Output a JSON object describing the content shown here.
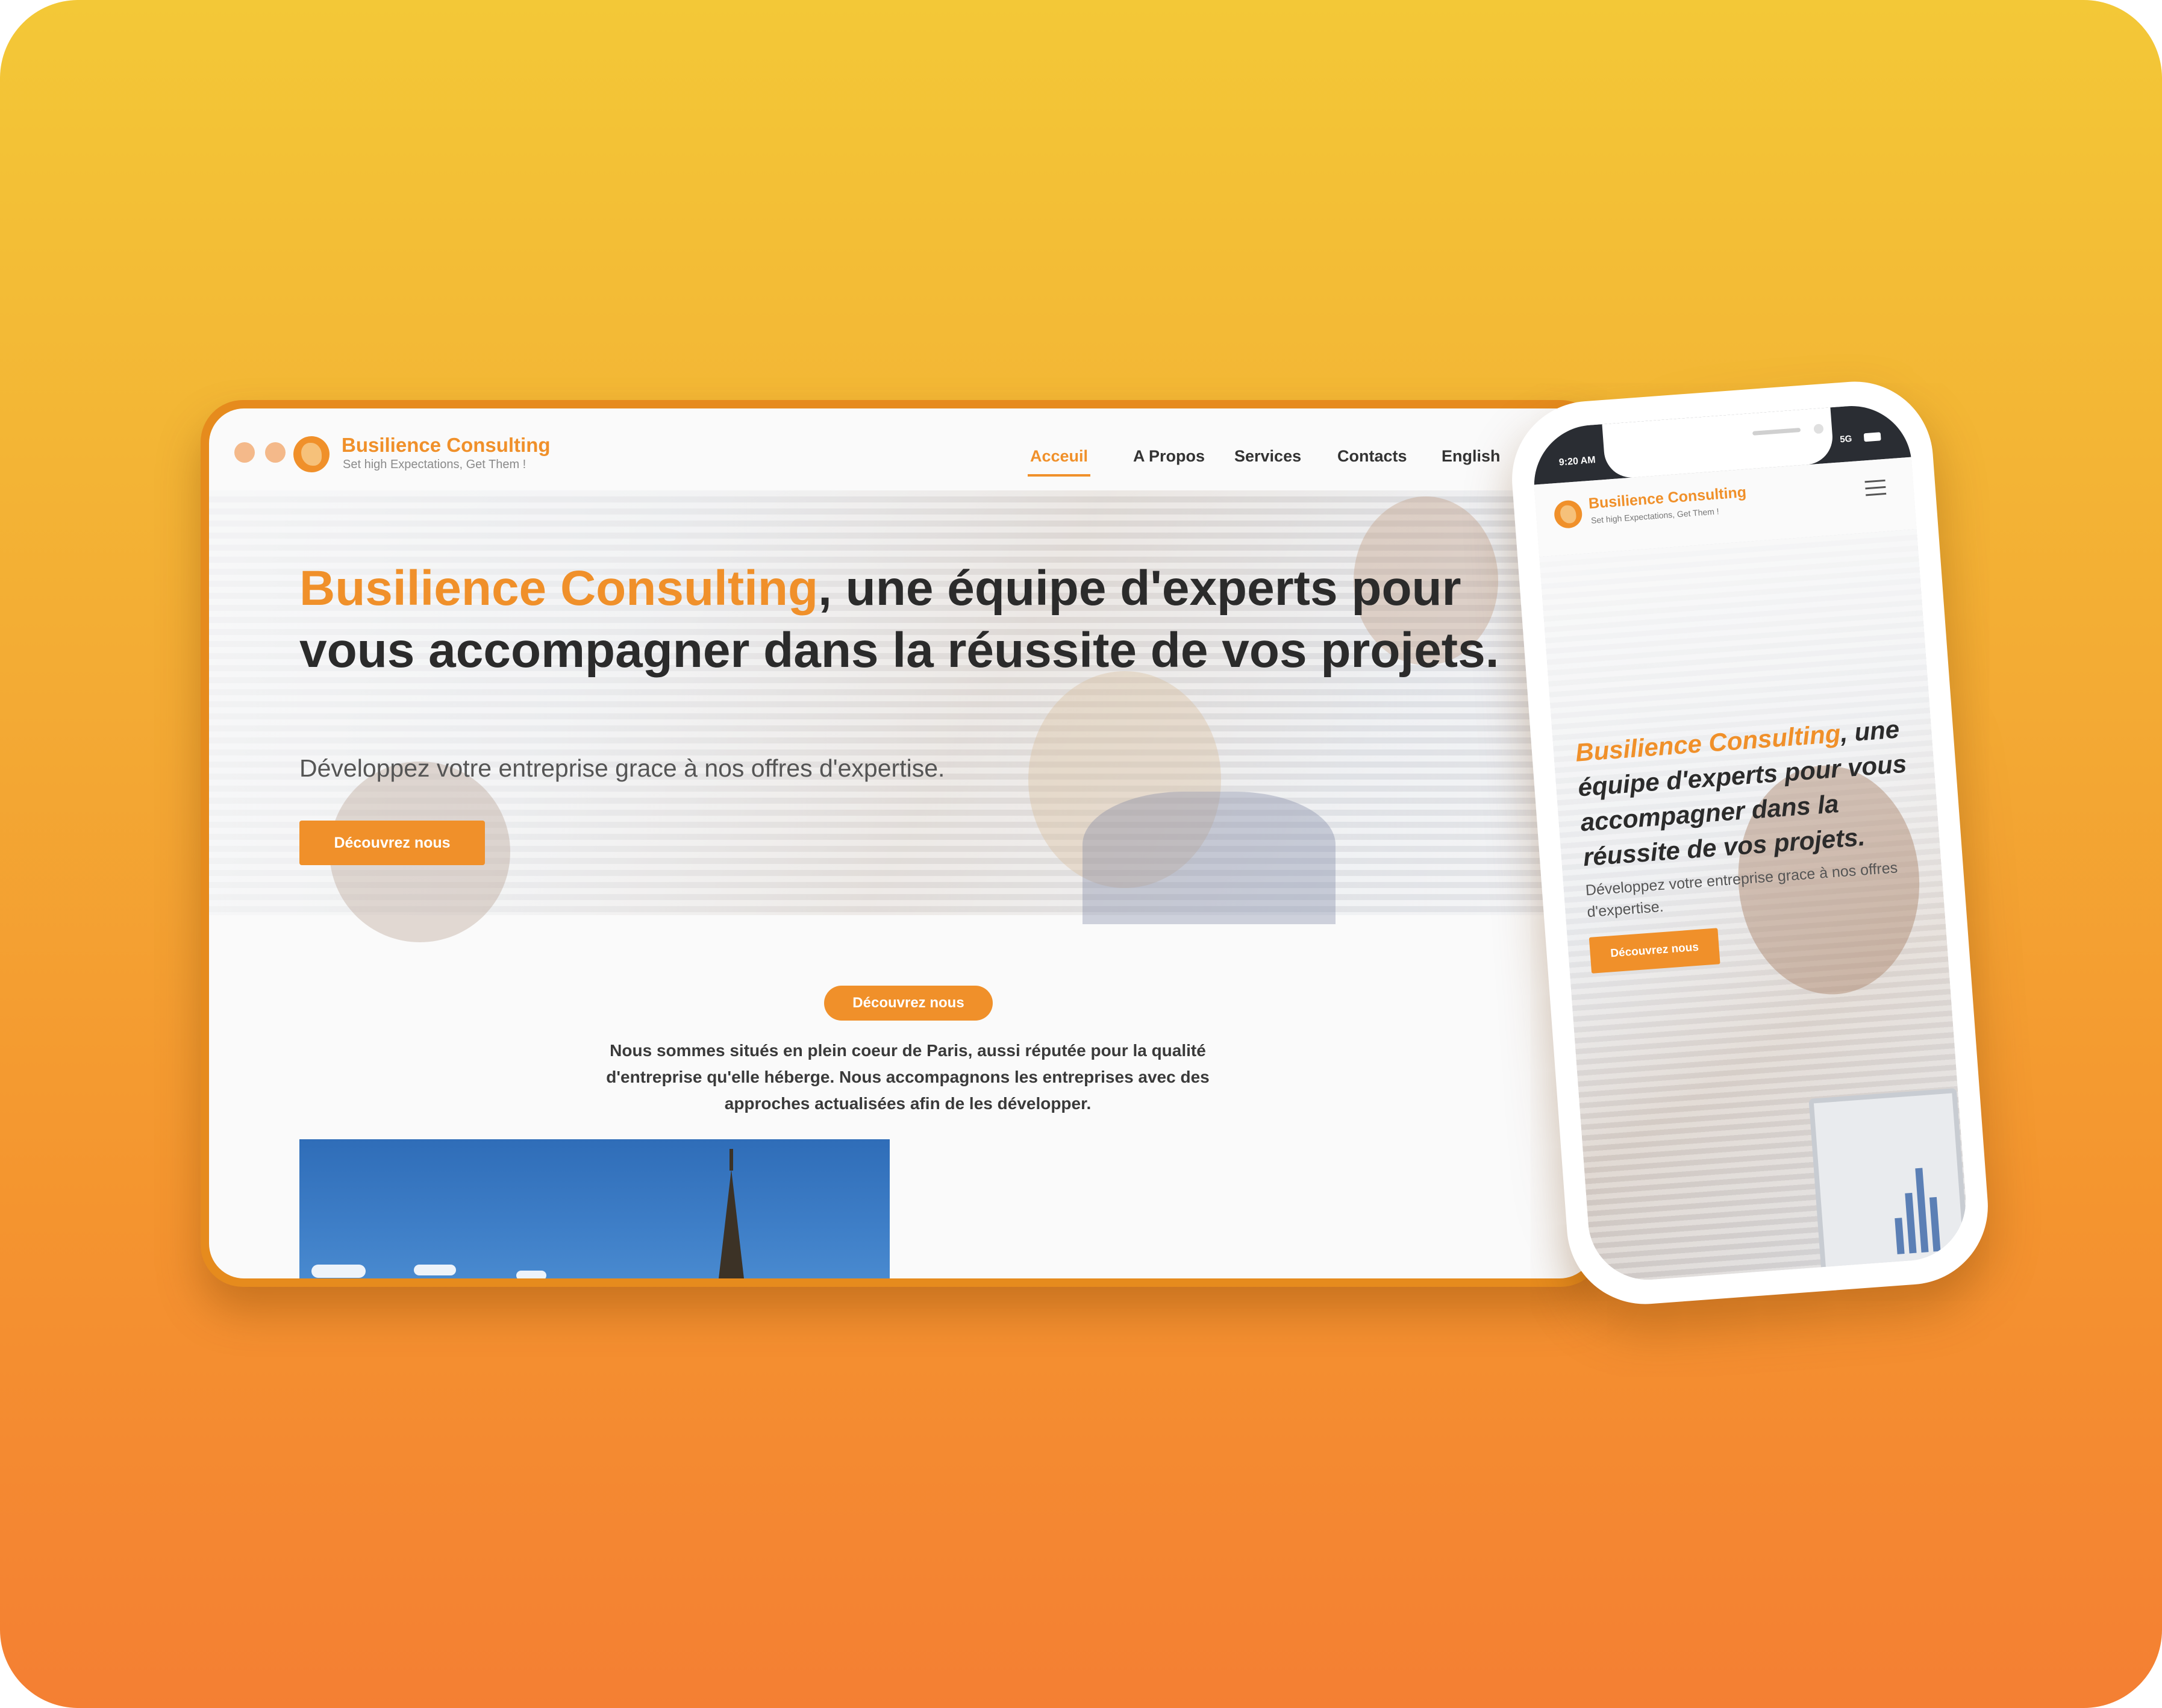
{
  "colors": {
    "accent": "#f0902a",
    "background_top": "#f3c837",
    "background_bottom": "#f47f33",
    "heading": "#2b2b2b"
  },
  "desktop": {
    "brand": {
      "name": "Busilience Consulting",
      "tagline": "Set high Expectations, Get Them !",
      "logo_icon": "globe-icon"
    },
    "nav": {
      "items": [
        "Acceuil",
        "A Propos",
        "Services",
        "Contacts",
        "English"
      ],
      "active": "Acceuil"
    },
    "hero": {
      "headline_accent": "Busilience Consulting",
      "headline_rest": ", une équipe d'experts pour vous accompagner dans la réussite de vos projets.",
      "subtitle": "Développez votre entreprise grace à nos offres d'expertise.",
      "cta": "Découvrez nous"
    },
    "about": {
      "pill": "Découvrez nous",
      "text": "Nous sommes situés en plein coeur de Paris, aussi réputée pour la qualité d'entreprise qu'elle héberge. Nous accompagnons les entreprises avec des approches actualisées afin de les développer."
    }
  },
  "phone": {
    "status": {
      "time": "9:20 AM",
      "network": "5G"
    },
    "brand": {
      "name": "Busilience Consulting",
      "tagline": "Set high Expectations, Get Them !",
      "menu_icon": "hamburger-menu-icon"
    },
    "hero": {
      "headline_accent": "Busilience Consulting",
      "headline_rest": ", une équipe d'experts pour vous accompagner dans la réussite de vos projets.",
      "subtitle": "Développez votre entreprise grace à nos offres d'expertise.",
      "cta": "Découvrez nous"
    }
  }
}
